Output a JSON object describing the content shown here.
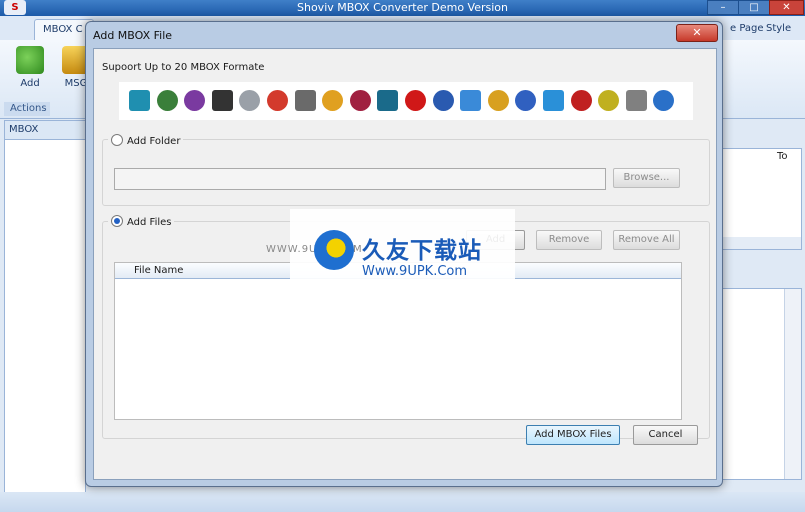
{
  "app": {
    "title": "Shoviv MBOX Converter Demo Version",
    "logo_text": "S",
    "window_controls": {
      "minimize": "–",
      "maximize": "□",
      "close": "✕"
    }
  },
  "ribbon": {
    "tabs": [
      "MBOX C",
      "e Page",
      "Style"
    ],
    "buttons": [
      {
        "label": "Add",
        "icon": "add-mailbox-icon"
      },
      {
        "label": "MSG",
        "icon": "msg-icon"
      }
    ],
    "group_label": "Actions"
  },
  "left_pane": {
    "header": "MBOX"
  },
  "right_pane": {
    "column_header": "To"
  },
  "dialog": {
    "title": "Add MBOX File",
    "close_glyph": "✕",
    "support_label": "Supoort Up to 20 MBOX Formate",
    "format_icons": [
      {
        "name": "thunderbird-icon",
        "color": "#1f8fb0"
      },
      {
        "name": "eudora-icon",
        "color": "#3a7f3a"
      },
      {
        "name": "entourage-icon",
        "color": "#7a3aa0"
      },
      {
        "name": "postbox-icon",
        "color": "#333333"
      },
      {
        "name": "mailcopa-icon",
        "color": "#9aa0a8"
      },
      {
        "name": "gmail-icon",
        "color": "#d33a2c"
      },
      {
        "name": "gnu-icon",
        "color": "#6a6a6a"
      },
      {
        "name": "g-mail-icon",
        "color": "#e0a020"
      },
      {
        "name": "claws-icon",
        "color": "#a02040"
      },
      {
        "name": "sea-monkey-icon",
        "color": "#1a6a8a"
      },
      {
        "name": "opera-icon",
        "color": "#d01818"
      },
      {
        "name": "netscape-icon",
        "color": "#2a5ab0"
      },
      {
        "name": "apple-mail-icon",
        "color": "#3a8ad8"
      },
      {
        "name": "pocomail-icon",
        "color": "#d8a020"
      },
      {
        "name": "spicebird-icon",
        "color": "#3060c0"
      },
      {
        "name": "cursor-mail-icon",
        "color": "#2a90d8"
      },
      {
        "name": "play-mail-icon",
        "color": "#c02020"
      },
      {
        "name": "sylpheed-icon",
        "color": "#c0b020"
      },
      {
        "name": "evolution-icon",
        "color": "#808080"
      },
      {
        "name": "mac-mail-icon",
        "color": "#2a70c8"
      }
    ],
    "add_folder": {
      "label": "Add Folder",
      "selected": false,
      "path_value": "",
      "browse_label": "Browse..."
    },
    "add_files": {
      "label": "Add Files",
      "selected": true,
      "add_label": "Add",
      "remove_label": "Remove",
      "remove_all_label": "Remove All",
      "list_header": "File Name",
      "files": []
    },
    "add_mbox_label": "Add MBOX Files",
    "cancel_label": "Cancel"
  },
  "watermark": {
    "url_left": "WWW.9UPK.COM",
    "cn_text": "久友下载站",
    "url": "Www.9UPK.Com"
  }
}
